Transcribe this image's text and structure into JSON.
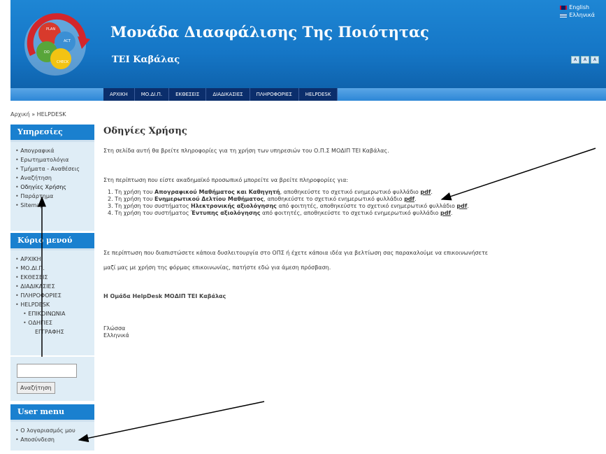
{
  "header": {
    "title": "Μονάδα Διασφάλισης Της Ποιότητας",
    "subtitle": "ΤΕΙ Καβάλας",
    "logo_labels": [
      "PLAN",
      "ACT",
      "DO",
      "CHECK"
    ],
    "languages": [
      "English",
      "Ελληνικά"
    ],
    "font_size_buttons": [
      "A",
      "A",
      "A"
    ]
  },
  "nav": {
    "items": [
      "ΑΡΧΙΚΗ",
      "ΜΟ.ΔΙ.Π.",
      "ΕΚΘΕΣΕΙΣ",
      "ΔΙΑΔΙΚΑΣΙΕΣ",
      "ΠΛΗΡΟΦΟΡΙΕΣ",
      "HELPDESK"
    ]
  },
  "breadcrumb": "Αρχική » HELPDESK",
  "services": {
    "title": "Υπηρεσίες",
    "items": [
      "Απογραφικά",
      "Ερωτηματολόγια",
      "Τμήματα - Αναθέσεις",
      "Αναζήτηση",
      "Οδηγίες Χρήσης",
      "Παράρτημα",
      "Sitemap"
    ]
  },
  "main_menu": {
    "title": "Κύριο μενού",
    "items": [
      "ΑΡΧΙΚΗ",
      "ΜΟ.ΔΙ.Π.",
      "ΕΚΘΕΣΕΙΣ",
      "ΔΙΑΔΙΚΑΣΙΕΣ",
      "ΠΛΗΡΟΦΟΡΙΕΣ",
      "HELPDESK"
    ],
    "sub_items": [
      "ΕΠΙΚΟΙΝΩΝΙΑ",
      "ΟΔΗΓΙΕΣ",
      "ΕΓΓΡΑΦΗΣ"
    ]
  },
  "search": {
    "value": "",
    "button": "Αναζήτηση"
  },
  "user_menu": {
    "title": "User menu",
    "items": [
      "Ο λογαριασμός μου",
      "Αποσύνδεση"
    ]
  },
  "content": {
    "title": "Οδηγίες Χρήσης",
    "intro": "Στη σελίδα αυτή θα βρείτε πληροφορίες για τη χρήση των υπηρεσιών του Ο.Π.Σ ΜΟΔΙΠ ΤΕΙ Καβάλας.",
    "intro2": "Στη περίπτωση που είστε ακαδημαϊκό προσωπικό μπορείτε να βρείτε πληροφορίες για:",
    "list": [
      {
        "num": "1.",
        "pre": "Τη χρήση του ",
        "bold": "Απογραφικού Μαθήματος και Καθηγητή",
        "post": ", αποθηκεύστε το σχετικό ενημερωτικό φυλλάδιο ",
        "link": "pdf",
        "end": "."
      },
      {
        "num": "2.",
        "pre": "Τη χρήση του ",
        "bold": "Ενημερωτικού Δελτίου Μαθήματος",
        "post": ", αποθηκεύστε το σχετικό ενημερωτικό φυλλάδιο ",
        "link": "pdf",
        "end": "."
      },
      {
        "num": "3.",
        "pre": "Τη χρήση του συστήματος ",
        "bold": "Ηλεκτρονικής αξιολόγησης",
        "post": " από φοιτητές, αποθηκεύστε το σχετικό ενημερωτικό φυλλάδιο ",
        "link": "pdf",
        "end": "."
      },
      {
        "num": "4.",
        "pre": "Τη χρήση του συστήματος ",
        "bold": "Έντυπης αξιολόγησης",
        "post": " από φοιτητές, αποθηκεύστε το σχετικό ενημερωτικό φυλλάδιο ",
        "link": "pdf",
        "end": "."
      }
    ],
    "para1": "Σε περίπτωση που διαπιστώσετε κάποια δυσλειτουργία στο ΟΠΣ ή έχετε κάποια ιδέα για βελτίωση σας παρακαλούμε να επικοινωνήσετε",
    "para2": "μαζί μας με χρήση της φόρμας επικοινωνίας, πατήστε εδώ για άμεση πρόσβαση.",
    "signature": "Η Ομάδα HelpDesk ΜΟΔΙΠ ΤΕΙ Καβάλας",
    "language_label": "Γλώσσα",
    "language_value": "Ελληνικά"
  },
  "colors": {
    "header": "#1576c6",
    "nav_item": "#0b2e6c",
    "block_title": "#1a80cf",
    "block_bg": "#dfedf6",
    "annotation_arrow": "#000000"
  }
}
